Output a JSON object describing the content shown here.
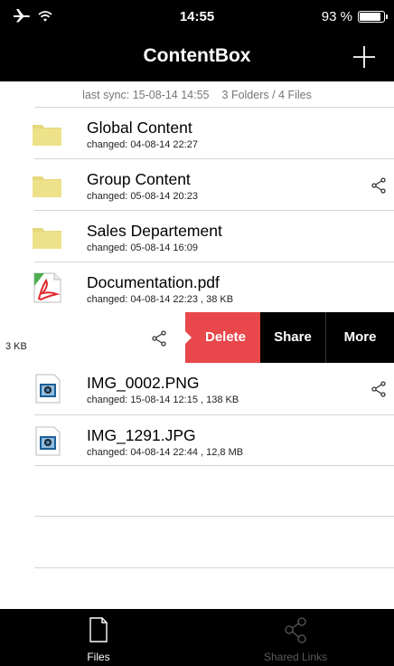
{
  "status_bar": {
    "time": "14:55",
    "battery_text": "93 %",
    "battery_level": 0.93
  },
  "nav": {
    "title": "ContentBox",
    "add_icon": "plus-icon"
  },
  "sync": {
    "last_sync": "last sync: 15-08-14  14:55",
    "summary": "3 Folders / 4 Files"
  },
  "items_top": [
    {
      "name": "Global Content",
      "meta": "changed: 04-08-14  22:27",
      "type": "folder",
      "shared": false
    },
    {
      "name": "Group Content",
      "meta": "changed: 05-08-14  20:23",
      "type": "folder",
      "shared": true
    },
    {
      "name": "Sales Departement",
      "meta": "changed: 05-08-14  16:09",
      "type": "folder",
      "shared": false
    },
    {
      "name": "Documentation.pdf",
      "meta": "changed: 04-08-14  22:23 , 38 KB",
      "type": "pdf",
      "shared": false
    }
  ],
  "swiped_row": {
    "leftover_text": "3 KB",
    "delete_label": "Delete",
    "share_label": "Share",
    "more_label": "More"
  },
  "items_bottom": [
    {
      "name": "IMG_0002.PNG",
      "meta": "changed: 15-08-14  12:15 , 138 KB",
      "type": "image",
      "shared": true
    },
    {
      "name": "IMG_1291.JPG",
      "meta": "changed: 04-08-14  22:44 , 12,8 MB",
      "type": "image",
      "shared": false
    }
  ],
  "tabs": [
    {
      "label": "Files",
      "icon": "file-icon",
      "active": true
    },
    {
      "label": "Shared Links",
      "icon": "share-icon",
      "active": false
    }
  ],
  "colors": {
    "bar_bg": "#000000",
    "delete": "#e8474b",
    "folder": "#ede28a"
  }
}
